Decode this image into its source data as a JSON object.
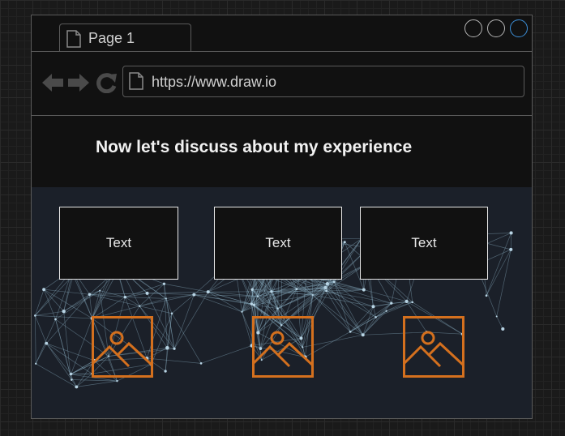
{
  "tab": {
    "label": "Page 1",
    "icon": "page-icon"
  },
  "window_controls": [
    {
      "name": "window-button-1",
      "color": "#b5b5b5"
    },
    {
      "name": "window-button-2",
      "color": "#b5b5b5"
    },
    {
      "name": "window-button-3",
      "color": "#3d8fd8"
    }
  ],
  "nav": {
    "back_icon": "arrow-left-icon",
    "forward_icon": "arrow-right-icon",
    "refresh_icon": "refresh-icon"
  },
  "address_bar": {
    "url": "https://www.draw.io"
  },
  "page": {
    "heading": "Now let's discuss about my experience"
  },
  "cards": [
    {
      "text": "Text",
      "icon": "image-icon"
    },
    {
      "text": "Text",
      "icon": "image-icon"
    },
    {
      "text": "Text",
      "icon": "image-icon"
    }
  ],
  "colors": {
    "accent_icon": "#d4701e",
    "background": "#111111",
    "content_bg": "#1b2029"
  }
}
